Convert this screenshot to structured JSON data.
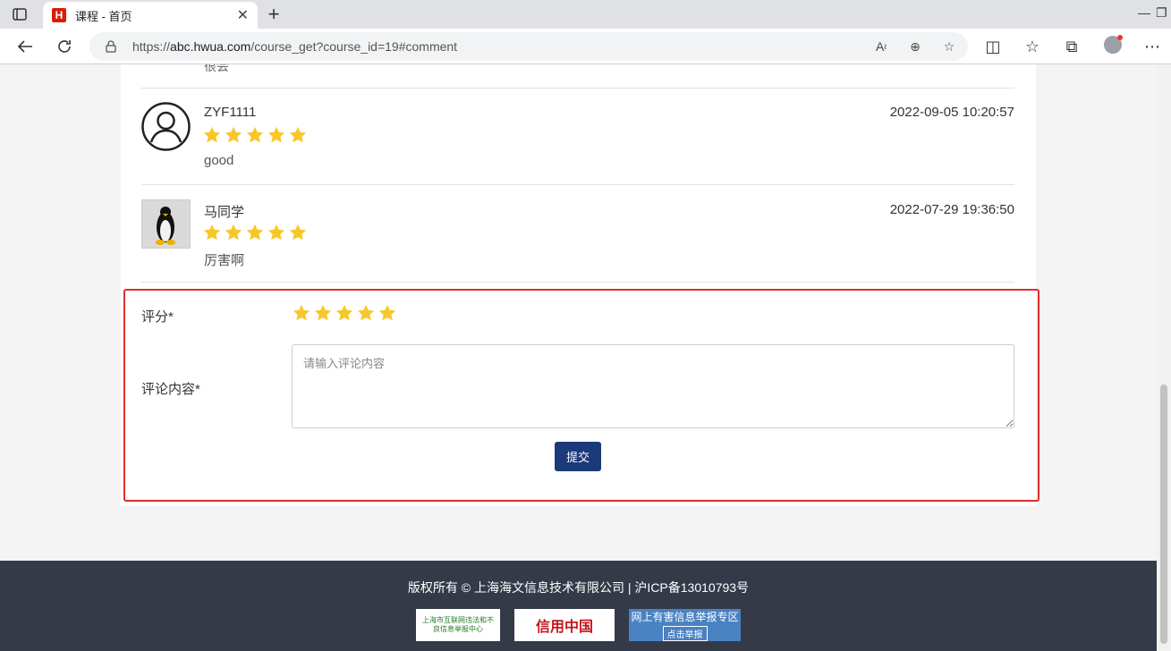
{
  "browser": {
    "tab_title": "课程 - 首页",
    "tab_favicon": "H",
    "url_prefix": "https://",
    "url_host": "abc.hwua.com",
    "url_path": "/course_get?course_id=19#comment"
  },
  "previous_comment_tail": "很会",
  "comments": [
    {
      "name": "ZYF1111",
      "time": "2022-09-05 10:20:57",
      "rating": 5,
      "text": "good",
      "avatar": "user-outline-icon"
    },
    {
      "name": "马同学",
      "time": "2022-07-29 19:36:50",
      "rating": 5,
      "text": "厉害啊",
      "avatar": "penguin-avatar"
    }
  ],
  "form": {
    "rating_label": "评分*",
    "rating_value": 5,
    "content_label": "评论内容*",
    "content_placeholder": "请输入评论内容",
    "submit_label": "提交"
  },
  "footer": {
    "copyright": "版权所有 © 上海海文信息技术有限公司 | 沪ICP备13010793号",
    "badge1": "上海市互联网违法和不良信息举报中心",
    "badge2": "信用中国",
    "badge3_title": "网上有害信息举报专区",
    "badge3_sub": "点击举报"
  },
  "colors": {
    "star": "#f7c72a",
    "highlight_border": "#e02d2d",
    "submit_bg": "#1b3a7a",
    "footer_bg": "#353a49"
  }
}
